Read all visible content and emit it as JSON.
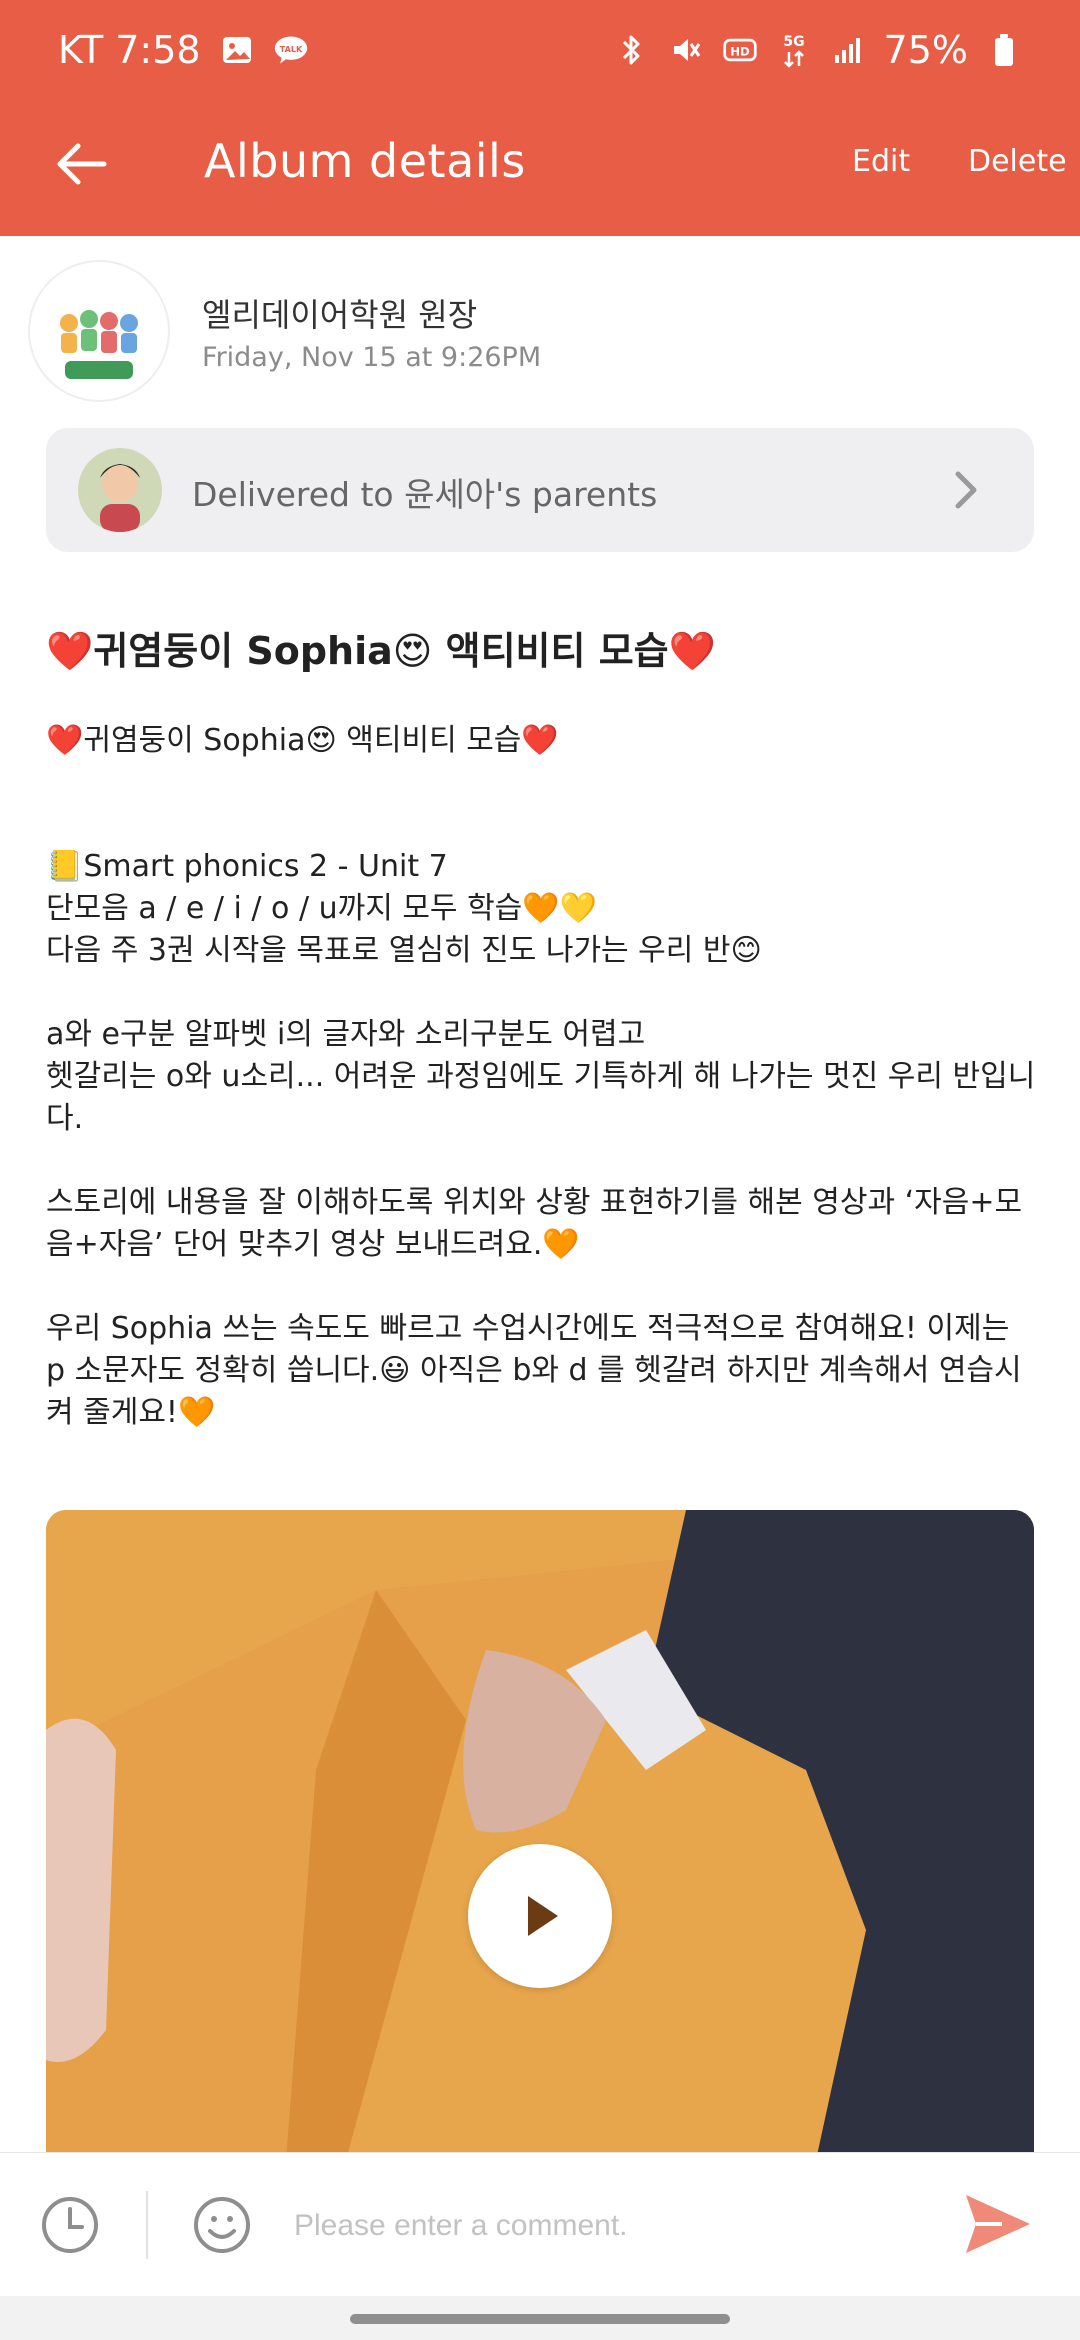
{
  "status_bar": {
    "carrier_time": "KT 7:58",
    "network_label": "5G",
    "battery": "75%"
  },
  "app_bar": {
    "title": "Album details",
    "edit_label": "Edit",
    "delete_label": "Delete"
  },
  "author": {
    "name": "엘리데이어학원 원장",
    "time": "Friday, Nov 15 at 9:26PM"
  },
  "delivered": {
    "text": "Delivered to 윤세아's parents"
  },
  "post": {
    "title": "❤️귀염둥이 Sophia😍 액티비티 모습❤️",
    "body": "❤️귀염둥이 Sophia😍 액티비티 모습❤️\n\n\n📒Smart phonics 2 - Unit 7\n단모음 a / e / i / o / u까지 모두 학습🧡💛\n다음 주 3권 시작을 목표로 열심히 진도 나가는 우리 반😊\n\na와 e구분 알파벳 i의 글자와 소리구분도 어렵고\n헷갈리는 o와 u소리... 어려운 과정임에도 기특하게 해 나가는 멋진 우리 반입니다.\n\n스토리에 내용을 잘 이해하도록 위치와 상황 표현하기를 해본 영상과 ‘자음+모음+자음’ 단어 맞추기 영상 보내드려요.🧡\n\n우리 Sophia 쓰는 속도도 빠르고 수업시간에도 적극적으로 참여해요! 이제는 p 소문자도 정확히 씁니다.😃 아직은 b와 d 를 헷갈려 하지만 계속해서 연습시켜 줄게요!🧡"
  },
  "comment_bar": {
    "placeholder": "Please enter a comment."
  },
  "icons": {
    "back": "arrow-left-icon",
    "gallery": "image-icon",
    "talk": "kakaotalk-icon",
    "bluetooth": "bluetooth-icon",
    "mute": "mute-icon",
    "hd": "hd-icon",
    "signal": "signal-icon",
    "battery": "battery-icon",
    "chevron": "chevron-right-icon",
    "play": "play-icon",
    "clock": "clock-icon",
    "emoji": "smiley-icon",
    "send": "send-icon"
  },
  "colors": {
    "brand": "#E85D45",
    "send": "#F08A78"
  }
}
